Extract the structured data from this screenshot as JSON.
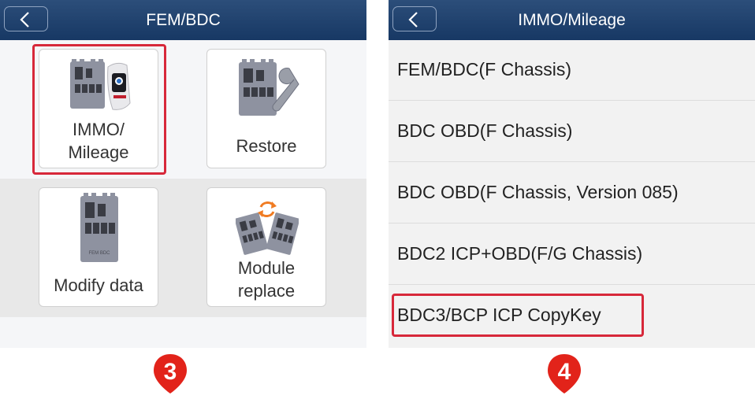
{
  "left_screen": {
    "header": {
      "title": "FEM/BDC",
      "back_icon": "chevron-left-icon"
    },
    "tiles": [
      {
        "label_line1": "IMMO/",
        "label_line2": "Mileage",
        "icon": "ecu-module-with-key-fob-icon"
      },
      {
        "label": "Restore",
        "icon": "ecu-module-with-wrench-icon"
      },
      {
        "label": "Modify data",
        "icon": "ecu-module-icon"
      },
      {
        "label_line1": "Module",
        "label_line2": "replace",
        "icon": "ecu-modules-swap-icon"
      }
    ],
    "module_text": "FEM BDC",
    "highlighted_item": "IMMO/ Mileage"
  },
  "right_screen": {
    "header": {
      "title": "IMMO/Mileage",
      "back_icon": "chevron-left-icon"
    },
    "items": [
      "FEM/BDC(F Chassis)",
      "BDC OBD(F Chassis)",
      "BDC OBD(F Chassis, Version 085)",
      "BDC2 ICP+OBD(F/G Chassis)",
      "BDC3/BCP ICP CopyKey"
    ],
    "highlighted_item": "BDC3/BCP ICP CopyKey"
  },
  "step_markers": [
    "3",
    "4"
  ],
  "colors": {
    "header_top": "#2c4e7a",
    "header_bottom": "#173864",
    "highlight": "#d7283a",
    "step_marker": "#e2231a",
    "module_gray": "#8e92a0",
    "swap_arrow": "#f07b22"
  }
}
